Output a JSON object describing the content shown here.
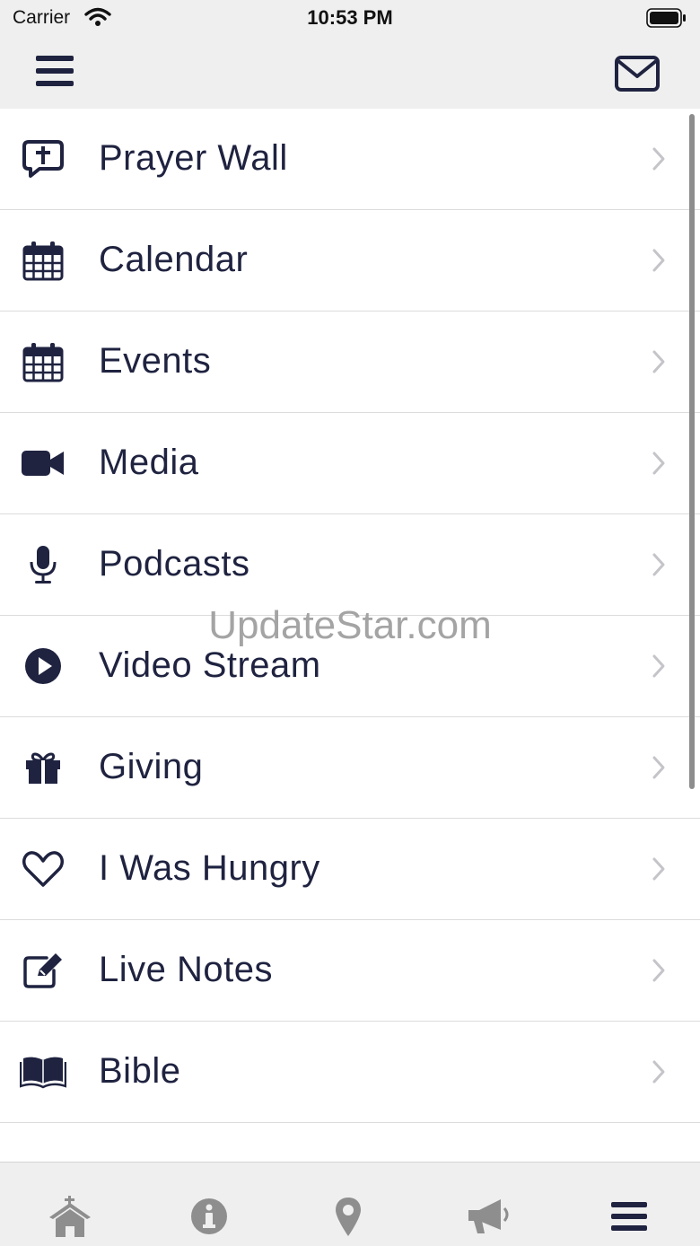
{
  "status": {
    "carrier": "Carrier",
    "time": "10:53 PM"
  },
  "nav": {
    "menu_icon": "hamburger-icon",
    "mail_icon": "envelope-icon"
  },
  "menu": [
    {
      "label": "Prayer Wall",
      "icon": "prayer-chat-icon"
    },
    {
      "label": "Calendar",
      "icon": "calendar-icon"
    },
    {
      "label": "Events",
      "icon": "calendar-icon"
    },
    {
      "label": "Media",
      "icon": "video-camera-icon"
    },
    {
      "label": "Podcasts",
      "icon": "microphone-icon"
    },
    {
      "label": "Video Stream",
      "icon": "play-circle-icon"
    },
    {
      "label": "Giving",
      "icon": "gift-icon"
    },
    {
      "label": "I Was Hungry",
      "icon": "heart-icon"
    },
    {
      "label": "Live Notes",
      "icon": "edit-note-icon"
    },
    {
      "label": "Bible",
      "icon": "book-icon"
    },
    {
      "label": "",
      "icon": "partial-icon"
    }
  ],
  "watermark": "UpdateStar.com",
  "tabs": [
    {
      "icon": "church-icon",
      "active": false
    },
    {
      "icon": "info-icon",
      "active": false
    },
    {
      "icon": "map-pin-icon",
      "active": false
    },
    {
      "icon": "megaphone-icon",
      "active": false
    },
    {
      "icon": "menu-icon",
      "active": true
    }
  ],
  "colors": {
    "icon": "#1f2340",
    "inactive_tab": "#8e8e8e",
    "chevron": "#c4c4c9",
    "bar": "#efefef"
  }
}
